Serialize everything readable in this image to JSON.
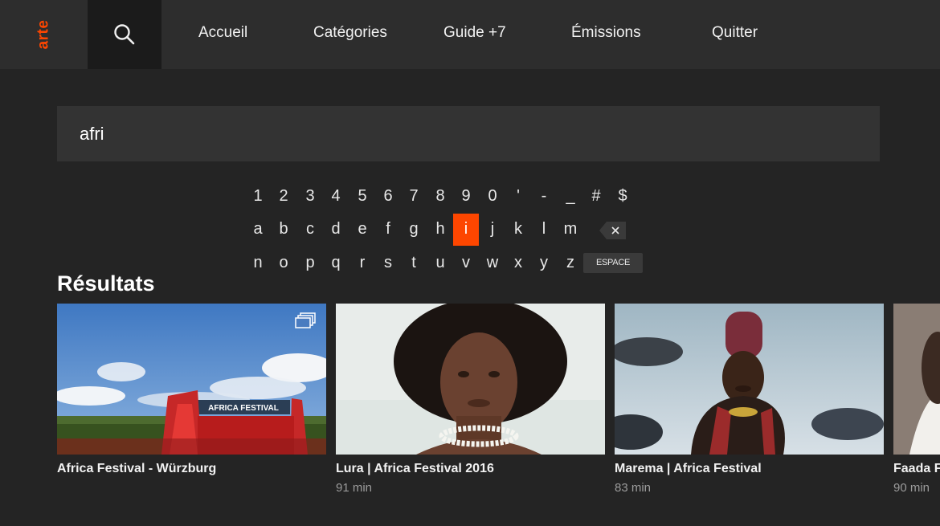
{
  "brand": {
    "logo": "arte",
    "accent_color": "#fd4600"
  },
  "nav": {
    "search_icon": "search-icon",
    "items": [
      {
        "label": "Accueil"
      },
      {
        "label": "Catégories"
      },
      {
        "label": "Guide +7"
      },
      {
        "label": "Émissions"
      },
      {
        "label": "Quitter"
      }
    ]
  },
  "search": {
    "value": "afri"
  },
  "keyboard": {
    "row1": [
      "1",
      "2",
      "3",
      "4",
      "5",
      "6",
      "7",
      "8",
      "9",
      "0",
      "'",
      "-",
      "_",
      "#",
      "$"
    ],
    "row2": [
      "a",
      "b",
      "c",
      "d",
      "e",
      "f",
      "g",
      "h",
      "i",
      "j",
      "k",
      "l",
      "m"
    ],
    "row3": [
      "n",
      "o",
      "p",
      "q",
      "r",
      "s",
      "t",
      "u",
      "v",
      "w",
      "x",
      "y",
      "z"
    ],
    "active_key": "i",
    "backspace_icon": "backspace-icon",
    "space_label": "ESPACE"
  },
  "results": {
    "heading": "Résultats",
    "items": [
      {
        "title": "Africa Festival - Würzburg",
        "duration": "",
        "badge_icon": "collection-icon"
      },
      {
        "title": "Lura | Africa Festival 2016",
        "duration": "91 min"
      },
      {
        "title": "Marema | Africa Festival",
        "duration": "83 min"
      },
      {
        "title": "Faada Fr",
        "duration": "90 min"
      }
    ],
    "banner_text": "AFRICA FESTIVAL"
  }
}
